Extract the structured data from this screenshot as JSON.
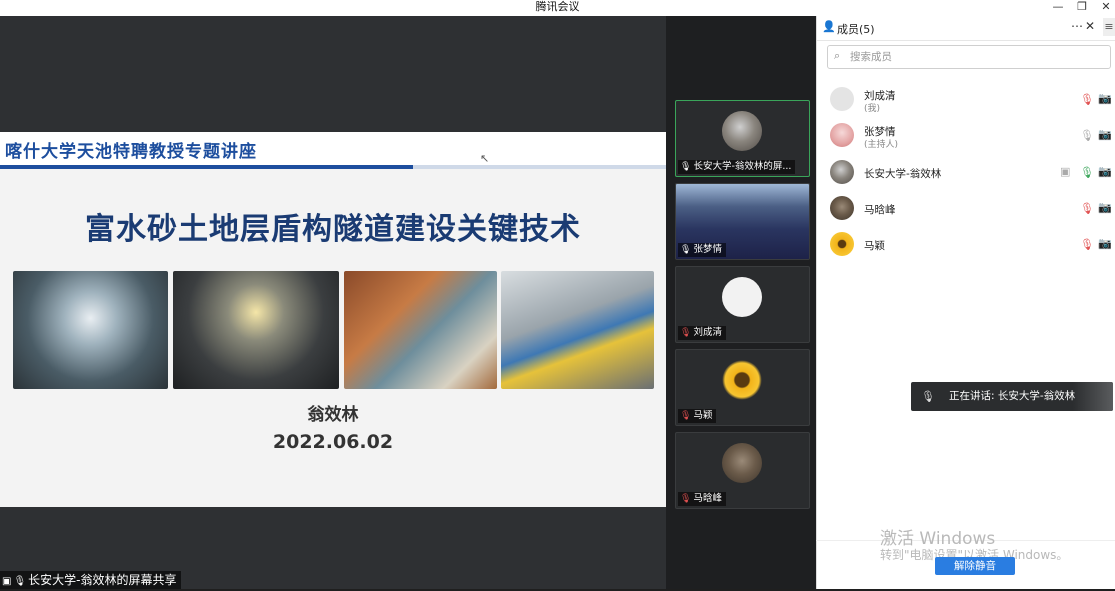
{
  "app": {
    "title": "腾讯会议"
  },
  "window_controls": {
    "minimize": "—",
    "restore": "❐",
    "close": "✕"
  },
  "slide": {
    "header": "喀什大学天池特聘教授专题讲座",
    "progress": 0.62,
    "title": "富水砂土地层盾构隧道建设关键技术",
    "author": "翁效林",
    "date": "2022.06.02"
  },
  "share_label": "长安大学-翁效林的屏幕共享",
  "video_tiles": [
    {
      "name": "长安大学-翁效林的屏...",
      "mic": "on",
      "active": true
    },
    {
      "name": "张梦情",
      "mic": "on",
      "active": false
    },
    {
      "name": "刘成清",
      "mic": "muted",
      "active": false
    },
    {
      "name": "马颖",
      "mic": "muted",
      "active": false
    },
    {
      "name": "马晗峰",
      "mic": "muted",
      "active": false
    }
  ],
  "panel": {
    "title": "成员(5)",
    "search_placeholder": "搜索成员",
    "members": [
      {
        "name": "刘成清",
        "role": "(我)",
        "mic": "muted",
        "cam": "off"
      },
      {
        "name": "张梦情",
        "role": "(主持人)",
        "mic": "on",
        "cam": "on"
      },
      {
        "name": "长安大学-翁效林",
        "role": "",
        "mic": "speaking",
        "cam": "off",
        "sharing": true
      },
      {
        "name": "马晗峰",
        "role": "",
        "mic": "muted",
        "cam": "off"
      },
      {
        "name": "马颖",
        "role": "",
        "mic": "muted",
        "cam": "off"
      }
    ]
  },
  "speaking": {
    "label": "正在讲话: 长安大学-翁效林"
  },
  "watermark": {
    "line1": "激活 Windows",
    "line2": "转到\"电脑设置\"以激活 Windows。"
  },
  "unmute_button": "解除静音",
  "colors": {
    "accent": "#2a7de1",
    "slide_blue": "#1d4e9e",
    "active_border": "#3aa55a",
    "muted_red": "#e05050"
  }
}
